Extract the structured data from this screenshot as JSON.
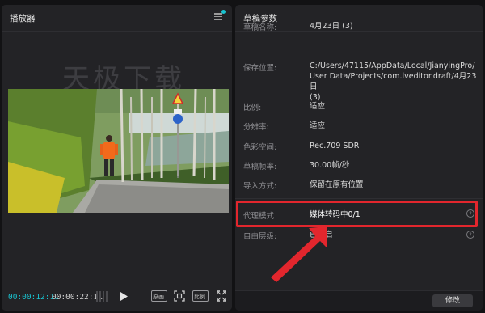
{
  "player": {
    "title": "播放器",
    "watermark": "天极下载",
    "current_time": "00:00:12:11",
    "total_time": "00:00:22:11",
    "controls": {
      "compare_label": "原画",
      "ratio_label": "比例"
    },
    "colors": {
      "current_time": "#19c4d1",
      "accent_dot": "#19c4d1"
    }
  },
  "draft": {
    "title": "草稿参数",
    "rows": [
      {
        "label": "草稿名称:",
        "value": "4月23日 (3)"
      },
      {
        "label": "保存位置:",
        "value_lines": [
          "C:/Users/47115/AppData/Local/JianyingPro/",
          "User Data/Projects/com.lveditor.draft/4月23日",
          "(3)"
        ]
      },
      {
        "label": "比例:",
        "value": "适应"
      },
      {
        "label": "分辨率:",
        "value": "适应"
      },
      {
        "label": "色彩空间:",
        "value": "Rec.709 SDR"
      },
      {
        "label": "草稿帧率:",
        "value": "30.00帧/秒"
      },
      {
        "label": "导入方式:",
        "value": "保留在原有位置"
      },
      {
        "label": "代理模式",
        "value": "媒体转码中0/1"
      },
      {
        "label": "自由层级:",
        "value": "已开启"
      }
    ],
    "modify_label": "修改",
    "highlight_color": "#e2262d"
  },
  "icons": [
    "menu-icon",
    "play-icon",
    "fit-screen-icon",
    "fullscreen-icon",
    "help-icon",
    "annotation-arrow"
  ]
}
